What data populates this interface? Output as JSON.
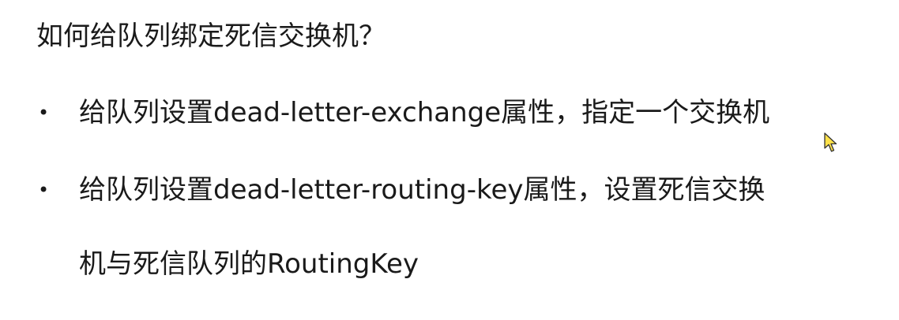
{
  "title": "如何给队列绑定死信交换机？",
  "bullets": [
    {
      "lines": [
        "给队列设置dead-letter-exchange属性，指定一个交换机"
      ]
    },
    {
      "lines": [
        "给队列设置dead-letter-routing-key属性，设置死信交换",
        "机与死信队列的RoutingKey"
      ]
    }
  ],
  "bullet_symbol": "•",
  "icons": {
    "cursor": "mouse-pointer-icon"
  }
}
